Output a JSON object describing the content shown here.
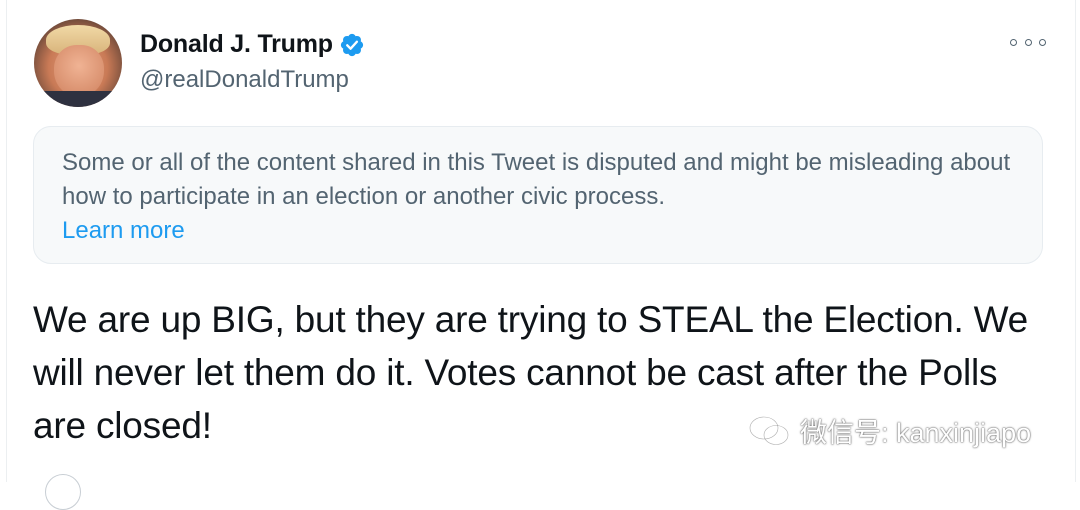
{
  "tweet": {
    "author": {
      "name": "Donald J. Trump",
      "handle": "@realDonaldTrump",
      "verified": true
    },
    "notice": {
      "text": "Some or all of the content shared in this Tweet is disputed and might be misleading about how to participate in an election or another civic process.",
      "link": "Learn more"
    },
    "body": "We are up BIG, but they are trying to STEAL the Election. We will never let them do it. Votes cannot be cast after the Polls are closed!"
  },
  "watermark": {
    "text": "微信号: kanxinjiapo"
  },
  "icons": {
    "verified": "verified-badge-icon",
    "more": "more-options-icon",
    "wechat": "wechat-icon"
  },
  "colors": {
    "accent": "#1d9bf0",
    "text": "#0f1419",
    "secondary_text": "#536471",
    "notice_bg": "#f7f9fa"
  }
}
